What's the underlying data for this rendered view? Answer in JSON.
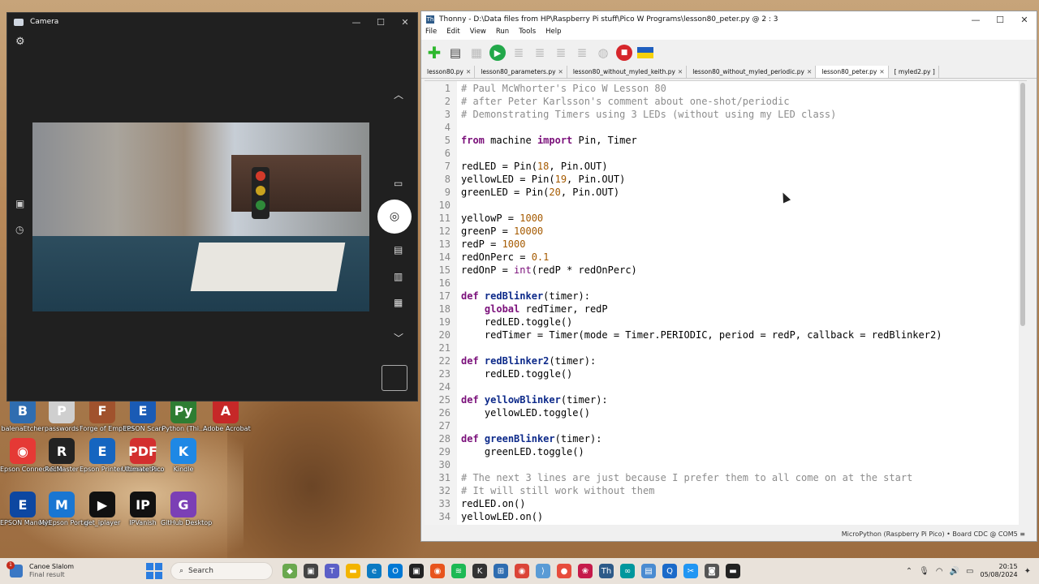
{
  "desktop": {
    "icons": [
      {
        "label": "balenaEtcher",
        "color": "#2f6db0",
        "glyph": "B"
      },
      {
        "label": "passwords",
        "color": "#cfcfcf",
        "glyph": "P"
      },
      {
        "label": "Forge of Empires",
        "color": "#a0522d",
        "glyph": "F"
      },
      {
        "label": "EPSON Scan",
        "color": "#1a5bb5",
        "glyph": "E"
      },
      {
        "label": "Python (Thi...",
        "color": "#2e7d32",
        "glyph": "Py"
      },
      {
        "label": "Adobe Acrobat",
        "color": "#c62828",
        "glyph": "A"
      },
      {
        "label": "Epson Connect Site",
        "color": "#e53935",
        "glyph": "◉"
      },
      {
        "label": "RecMaster",
        "color": "#222222",
        "glyph": "R"
      },
      {
        "label": "Epson Printer Connectio...",
        "color": "#1565c0",
        "glyph": "E"
      },
      {
        "label": "Ultimate Pico",
        "color": "#d32f2f",
        "glyph": "PDF"
      },
      {
        "label": "Kindle",
        "color": "#1e88e5",
        "glyph": "K"
      },
      {
        "label": "EPSON Manuals",
        "color": "#0d47a1",
        "glyph": "E"
      },
      {
        "label": "MyEpson Portal",
        "color": "#1976d2",
        "glyph": "M"
      },
      {
        "label": "get_iplayer",
        "color": "#111111",
        "glyph": "▶"
      },
      {
        "label": "IPVanish",
        "color": "#111111",
        "glyph": "IP"
      },
      {
        "label": "GitHub Desktop",
        "color": "#7b3fb5",
        "glyph": "G"
      }
    ]
  },
  "camera": {
    "title": "Camera"
  },
  "thonny": {
    "title": "Thonny  -  D:\\Data files from HP\\Raspberry Pi stuff\\Pico W Programs\\lesson80_peter.py  @  2 : 3",
    "menu": [
      "File",
      "Edit",
      "View",
      "Run",
      "Tools",
      "Help"
    ],
    "tabs": [
      {
        "label": "lesson80.py",
        "active": false
      },
      {
        "label": "lesson80_parameters.py",
        "active": false
      },
      {
        "label": "lesson80_without_myled_keith.py",
        "active": false
      },
      {
        "label": "lesson80_without_myled_periodic.py",
        "active": false
      },
      {
        "label": "lesson80_peter.py",
        "active": true
      },
      {
        "label": "[ myled2.py ]",
        "active": false
      }
    ],
    "status": "MicroPython (Raspberry Pi Pico)  •  Board CDC @ COM5  ≡",
    "code_lines": [
      [
        {
          "t": "cm",
          "s": "# Paul McWhorter's Pico W Lesson 80"
        }
      ],
      [
        {
          "t": "cm",
          "s": "# after Peter Karlsson's comment about one-shot/periodic"
        }
      ],
      [
        {
          "t": "cm",
          "s": "# Demonstrating Timers using 3 LEDs (without using my LED class)"
        }
      ],
      [],
      [
        {
          "t": "kw",
          "s": "from"
        },
        {
          "t": "",
          "s": " machine "
        },
        {
          "t": "kw",
          "s": "import"
        },
        {
          "t": "",
          "s": " Pin, Timer"
        }
      ],
      [],
      [
        {
          "t": "",
          "s": "redLED = Pin("
        },
        {
          "t": "nm",
          "s": "18"
        },
        {
          "t": "",
          "s": ", Pin.OUT)"
        }
      ],
      [
        {
          "t": "",
          "s": "yellowLED = Pin("
        },
        {
          "t": "nm",
          "s": "19"
        },
        {
          "t": "",
          "s": ", Pin.OUT)"
        }
      ],
      [
        {
          "t": "",
          "s": "greenLED = Pin("
        },
        {
          "t": "nm",
          "s": "20"
        },
        {
          "t": "",
          "s": ", Pin.OUT)"
        }
      ],
      [],
      [
        {
          "t": "",
          "s": "yellowP = "
        },
        {
          "t": "nm",
          "s": "1000"
        }
      ],
      [
        {
          "t": "",
          "s": "greenP = "
        },
        {
          "t": "nm",
          "s": "10000"
        }
      ],
      [
        {
          "t": "",
          "s": "redP = "
        },
        {
          "t": "nm",
          "s": "1000"
        }
      ],
      [
        {
          "t": "",
          "s": "redOnPerc = "
        },
        {
          "t": "nm",
          "s": "0.1"
        }
      ],
      [
        {
          "t": "",
          "s": "redOnP = "
        },
        {
          "t": "bi",
          "s": "int"
        },
        {
          "t": "",
          "s": "(redP * redOnPerc)"
        }
      ],
      [],
      [
        {
          "t": "kw",
          "s": "def"
        },
        {
          "t": "",
          "s": " "
        },
        {
          "t": "fn",
          "s": "redBlinker"
        },
        {
          "t": "",
          "s": "(timer):"
        }
      ],
      [
        {
          "t": "",
          "s": "    "
        },
        {
          "t": "kw",
          "s": "global"
        },
        {
          "t": "",
          "s": " redTimer, redP"
        }
      ],
      [
        {
          "t": "",
          "s": "    redLED.toggle()"
        }
      ],
      [
        {
          "t": "",
          "s": "    redTimer = Timer(mode = Timer.PERIODIC, period = redP, callback = redBlinker2)"
        }
      ],
      [],
      [
        {
          "t": "kw",
          "s": "def"
        },
        {
          "t": "",
          "s": " "
        },
        {
          "t": "fn",
          "s": "redBlinker2"
        },
        {
          "t": "",
          "s": "(timer):"
        }
      ],
      [
        {
          "t": "",
          "s": "    redLED.toggle()"
        }
      ],
      [],
      [
        {
          "t": "kw",
          "s": "def"
        },
        {
          "t": "",
          "s": " "
        },
        {
          "t": "fn",
          "s": "yellowBlinker"
        },
        {
          "t": "",
          "s": "(timer):"
        }
      ],
      [
        {
          "t": "",
          "s": "    yellowLED.toggle()"
        }
      ],
      [],
      [
        {
          "t": "kw",
          "s": "def"
        },
        {
          "t": "",
          "s": " "
        },
        {
          "t": "fn",
          "s": "greenBlinker"
        },
        {
          "t": "",
          "s": "(timer):"
        }
      ],
      [
        {
          "t": "",
          "s": "    greenLED.toggle()"
        }
      ],
      [],
      [
        {
          "t": "cm",
          "s": "# The next 3 lines are just because I prefer them to all come on at the start"
        }
      ],
      [
        {
          "t": "cm",
          "s": "# It will still work without them"
        }
      ],
      [
        {
          "t": "",
          "s": "redLED.on()"
        }
      ],
      [
        {
          "t": "",
          "s": "yellowLED.on()"
        }
      ]
    ]
  },
  "taskbar": {
    "notification_title": "Canoe Slalom",
    "notification_sub": "Final result",
    "notification_count": "1",
    "search_label": "Search",
    "time": "20:15",
    "date": "05/08/2024"
  }
}
